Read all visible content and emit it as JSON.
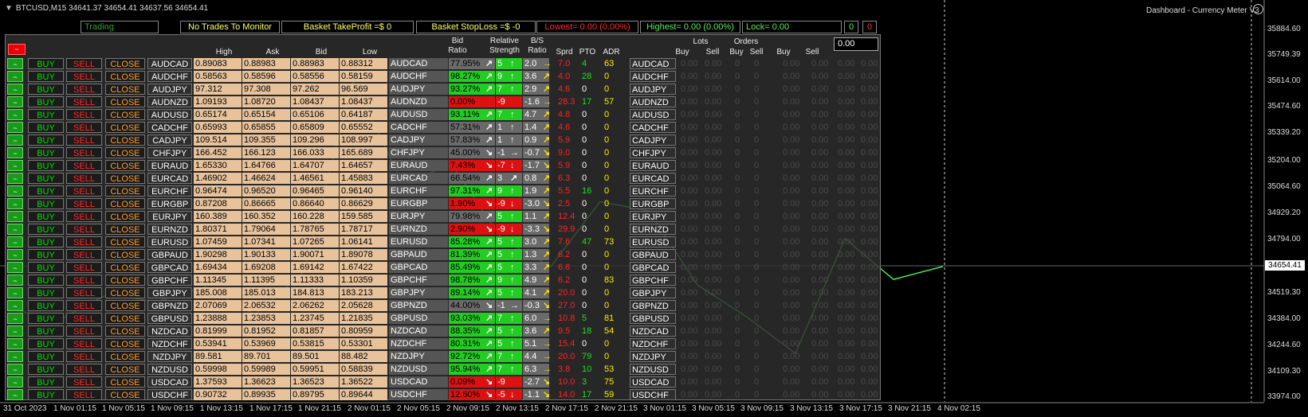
{
  "window": {
    "title": "BTCUSD,M15  34641.37 34654.41 34637.56 34654.41",
    "dashboard_name": "Dashboard - Currency Meter V3"
  },
  "top_bar": {
    "status": "Trading",
    "trades_monitor": "No Trades To Monitor",
    "basket_tp": "Basket TakeProfit =$ 0",
    "basket_sl": "Basket StopLoss =$ -0",
    "lowest": "Lowest= 0.00 (0.00%)",
    "highest": "Highest= 0.00 (0.00%)",
    "lock": "Lock= 0.00",
    "count_green": "0",
    "count_red": "0"
  },
  "headers": {
    "high": "High",
    "ask": "Ask",
    "bid": "Bid",
    "low": "Low",
    "bid_ratio_1": "Bid",
    "bid_ratio_2": "Ratio",
    "rel_strength_1": "Relative",
    "rel_strength_2": "Strength",
    "bs_ratio_1": "B/S",
    "bs_ratio_2": "Ratio",
    "sprd": "Sprd",
    "pto": "PTO",
    "adr": "ADR",
    "lots": "Lots",
    "orders": "Orders",
    "buy1": "Buy",
    "sell1": "Sell",
    "buy2": "Buy",
    "sell2": "Sell",
    "buy3": "Buy",
    "sell3": "Sell",
    "lots_value": "0.00"
  },
  "labels": {
    "toggle": "~",
    "buy": "BUY",
    "sell": "SELL",
    "close": "CLOSE",
    "zero": "0.00",
    "zero_int": "0"
  },
  "colors": {
    "ratio_green": "#22cc22",
    "ratio_red": "#dd1111",
    "ratio_gray": "#6a6a6a",
    "chart_line": "#4cff4c",
    "grid": "#d0d0d0"
  },
  "rows": [
    {
      "symbol": "AUDCAD",
      "high": "0.89083",
      "ask": "0.88983",
      "bid": "0.88983",
      "low": "0.88312",
      "ratio": "77.95%",
      "ratio_color": "gray",
      "rarrow": "↗",
      "strength": "5",
      "sarrow": "↑",
      "bs": "2.0",
      "barrow": "→",
      "sprd": "7.0",
      "pto": "4",
      "adr": "63"
    },
    {
      "symbol": "AUDCHF",
      "high": "0.58563",
      "ask": "0.58596",
      "bid": "0.58556",
      "low": "0.58159",
      "ratio": "98.27%",
      "ratio_color": "green",
      "rarrow": "↗",
      "strength": "9",
      "sarrow": "↑",
      "bs": "3.6",
      "barrow": "↗",
      "sprd": "4.0",
      "pto": "28",
      "adr": "0"
    },
    {
      "symbol": "AUDJPY",
      "high": "97.312",
      "ask": "97.308",
      "bid": "97.262",
      "low": "96.569",
      "ratio": "93.27%",
      "ratio_color": "green",
      "rarrow": "↗",
      "strength": "7",
      "sarrow": "↑",
      "bs": "2.9",
      "barrow": "↗",
      "sprd": "4.6",
      "pto": "0",
      "adr": "0"
    },
    {
      "symbol": "AUDNZD",
      "high": "1.09193",
      "ask": "1.08720",
      "bid": "1.08437",
      "low": "1.08437",
      "ratio": "0.00%",
      "ratio_color": "red",
      "rarrow": "",
      "strength": "-9",
      "sarrow": "",
      "bs": "-1.6",
      "barrow": "→",
      "sprd": "28.3",
      "pto": "17",
      "adr": "57"
    },
    {
      "symbol": "AUDUSD",
      "high": "0.65174",
      "ask": "0.65154",
      "bid": "0.65106",
      "low": "0.64187",
      "ratio": "93.11%",
      "ratio_color": "green",
      "rarrow": "↗",
      "strength": "7",
      "sarrow": "↑",
      "bs": "4.7",
      "barrow": "↗",
      "sprd": "4.8",
      "pto": "0",
      "adr": "0"
    },
    {
      "symbol": "CADCHF",
      "high": "0.65993",
      "ask": "0.65855",
      "bid": "0.65809",
      "low": "0.65552",
      "ratio": "57.31%",
      "ratio_color": "gray",
      "rarrow": "↗",
      "strength": "1",
      "sarrow": "↑",
      "bs": "1.4",
      "barrow": "↗",
      "sprd": "4.6",
      "pto": "0",
      "adr": "0"
    },
    {
      "symbol": "CADJPY",
      "high": "109.514",
      "ask": "109.355",
      "bid": "109.296",
      "low": "108.997",
      "ratio": "57.83%",
      "ratio_color": "gray",
      "rarrow": "↗",
      "strength": "1",
      "sarrow": "↑",
      "bs": "0.9",
      "barrow": "↗",
      "sprd": "5.9",
      "pto": "0",
      "adr": "0"
    },
    {
      "symbol": "CHFJPY",
      "high": "166.452",
      "ask": "166.123",
      "bid": "166.033",
      "low": "165.689",
      "ratio": "45.00%",
      "ratio_color": "gray",
      "rarrow": "↘",
      "strength": "-1",
      "sarrow": "→",
      "bs": "-0.7",
      "barrow": "↘",
      "sprd": "9.0",
      "pto": "0",
      "adr": "0"
    },
    {
      "symbol": "EURAUD",
      "high": "1.65330",
      "ask": "1.64766",
      "bid": "1.64707",
      "low": "1.64657",
      "ratio": "7.43%",
      "ratio_color": "red",
      "rarrow": "↘",
      "strength": "-7",
      "sarrow": "↓",
      "bs": "-1.7",
      "barrow": "↘",
      "sprd": "5.9",
      "pto": "0",
      "adr": "0"
    },
    {
      "symbol": "EURCAD",
      "high": "1.46902",
      "ask": "1.46624",
      "bid": "1.46561",
      "low": "1.45883",
      "ratio": "66.54%",
      "ratio_color": "gray",
      "rarrow": "↗",
      "strength": "3",
      "sarrow": "↗",
      "bs": "0.8",
      "barrow": "↗",
      "sprd": "6.3",
      "pto": "0",
      "adr": "0"
    },
    {
      "symbol": "EURCHF",
      "high": "0.96474",
      "ask": "0.96520",
      "bid": "0.96465",
      "low": "0.96140",
      "ratio": "97.31%",
      "ratio_color": "green",
      "rarrow": "↗",
      "strength": "9",
      "sarrow": "↑",
      "bs": "1.9",
      "barrow": "↗",
      "sprd": "5.5",
      "pto": "16",
      "adr": "0"
    },
    {
      "symbol": "EURGBP",
      "high": "0.87208",
      "ask": "0.86665",
      "bid": "0.86640",
      "low": "0.86629",
      "ratio": "1.90%",
      "ratio_color": "red",
      "rarrow": "↘",
      "strength": "-9",
      "sarrow": "↓",
      "bs": "-3.0",
      "barrow": "↘",
      "sprd": "2.5",
      "pto": "0",
      "adr": "0"
    },
    {
      "symbol": "EURJPY",
      "high": "160.389",
      "ask": "160.352",
      "bid": "160.228",
      "low": "159.585",
      "ratio": "79.98%",
      "ratio_color": "gray",
      "rarrow": "↗",
      "strength": "5",
      "sarrow": "↑",
      "bs": "1.1",
      "barrow": "↗",
      "sprd": "12.4",
      "pto": "0",
      "adr": "0"
    },
    {
      "symbol": "EURNZD",
      "high": "1.80371",
      "ask": "1.79064",
      "bid": "1.78765",
      "low": "1.78717",
      "ratio": "2.90%",
      "ratio_color": "red",
      "rarrow": "↘",
      "strength": "-9",
      "sarrow": "↓",
      "bs": "-3.3",
      "barrow": "↘",
      "sprd": "29.9",
      "pto": "0",
      "adr": "0"
    },
    {
      "symbol": "EURUSD",
      "high": "1.07459",
      "ask": "1.07341",
      "bid": "1.07265",
      "low": "1.06141",
      "ratio": "85.28%",
      "ratio_color": "green",
      "rarrow": "↗",
      "strength": "5",
      "sarrow": "↑",
      "bs": "3.0",
      "barrow": "↗",
      "sprd": "7.6",
      "pto": "47",
      "adr": "73"
    },
    {
      "symbol": "GBPAUD",
      "high": "1.90298",
      "ask": "1.90133",
      "bid": "1.90071",
      "low": "1.89078",
      "ratio": "81.39%",
      "ratio_color": "green",
      "rarrow": "↗",
      "strength": "5",
      "sarrow": "↑",
      "bs": "1.3",
      "barrow": "↗",
      "sprd": "6.2",
      "pto": "0",
      "adr": "0"
    },
    {
      "symbol": "GBPCAD",
      "high": "1.69434",
      "ask": "1.69208",
      "bid": "1.69142",
      "low": "1.67422",
      "ratio": "85.49%",
      "ratio_color": "green",
      "rarrow": "↗",
      "strength": "5",
      "sarrow": "↑",
      "bs": "3.3",
      "barrow": "↗",
      "sprd": "6.6",
      "pto": "0",
      "adr": "0"
    },
    {
      "symbol": "GBPCHF",
      "high": "1.11345",
      "ask": "1.11395",
      "bid": "1.11333",
      "low": "1.10359",
      "ratio": "98.78%",
      "ratio_color": "green",
      "rarrow": "↗",
      "strength": "9",
      "sarrow": "↑",
      "bs": "4.9",
      "barrow": "↗",
      "sprd": "6.2",
      "pto": "0",
      "adr": "83"
    },
    {
      "symbol": "GBPJPY",
      "high": "185.008",
      "ask": "185.013",
      "bid": "184.813",
      "low": "183.213",
      "ratio": "89.14%",
      "ratio_color": "green",
      "rarrow": "↗",
      "strength": "5",
      "sarrow": "↑",
      "bs": "4.1",
      "barrow": "↗",
      "sprd": "20.0",
      "pto": "0",
      "adr": "0"
    },
    {
      "symbol": "GBPNZD",
      "high": "2.07069",
      "ask": "2.06532",
      "bid": "2.06262",
      "low": "2.05628",
      "ratio": "44.00%",
      "ratio_color": "gray",
      "rarrow": "↘",
      "strength": "-1",
      "sarrow": "→",
      "bs": "-0.3",
      "barrow": "↘",
      "sprd": "27.0",
      "pto": "0",
      "adr": "0"
    },
    {
      "symbol": "GBPUSD",
      "high": "1.23888",
      "ask": "1.23853",
      "bid": "1.23745",
      "low": "1.21835",
      "ratio": "93.03%",
      "ratio_color": "green",
      "rarrow": "↗",
      "strength": "7",
      "sarrow": "↑",
      "bs": "6.0",
      "barrow": "→",
      "sprd": "10.8",
      "pto": "5",
      "adr": "81"
    },
    {
      "symbol": "NZDCAD",
      "high": "0.81999",
      "ask": "0.81952",
      "bid": "0.81857",
      "low": "0.80959",
      "ratio": "88.35%",
      "ratio_color": "green",
      "rarrow": "↗",
      "strength": "5",
      "sarrow": "↑",
      "bs": "3.6",
      "barrow": "↗",
      "sprd": "9.5",
      "pto": "18",
      "adr": "54"
    },
    {
      "symbol": "NZDCHF",
      "high": "0.53941",
      "ask": "0.53969",
      "bid": "0.53815",
      "low": "0.53301",
      "ratio": "80.31%",
      "ratio_color": "green",
      "rarrow": "↗",
      "strength": "5",
      "sarrow": "↑",
      "bs": "5.1",
      "barrow": "→",
      "sprd": "15.4",
      "pto": "0",
      "adr": "0"
    },
    {
      "symbol": "NZDJPY",
      "high": "89.581",
      "ask": "89.701",
      "bid": "89.501",
      "low": "88.482",
      "ratio": "92.72%",
      "ratio_color": "green",
      "rarrow": "↗",
      "strength": "7",
      "sarrow": "↑",
      "bs": "4.4",
      "barrow": "→",
      "sprd": "20.0",
      "pto": "79",
      "adr": "0"
    },
    {
      "symbol": "NZDUSD",
      "high": "0.59998",
      "ask": "0.59989",
      "bid": "0.59951",
      "low": "0.58839",
      "ratio": "95.94%",
      "ratio_color": "green",
      "rarrow": "↗",
      "strength": "7",
      "sarrow": "↑",
      "bs": "6.3",
      "barrow": "→",
      "sprd": "3.8",
      "pto": "10",
      "adr": "53"
    },
    {
      "symbol": "USDCAD",
      "high": "1.37593",
      "ask": "1.36623",
      "bid": "1.36523",
      "low": "1.36522",
      "ratio": "0.09%",
      "ratio_color": "red",
      "rarrow": "↘",
      "strength": "-9",
      "sarrow": "",
      "bs": "-2.7",
      "barrow": "↘",
      "sprd": "10.0",
      "pto": "3",
      "adr": "75"
    },
    {
      "symbol": "USDCHF",
      "high": "0.90732",
      "ask": "0.89935",
      "bid": "0.89795",
      "low": "0.89644",
      "ratio": "12.60%",
      "ratio_color": "red",
      "rarrow": "↘",
      "strength": "-5",
      "sarrow": "↓",
      "bs": "-1.1",
      "barrow": "↘",
      "sprd": "14.0",
      "pto": "17",
      "adr": "59"
    }
  ],
  "x_axis": [
    "31 Oct 2023",
    "1 Nov 01:15",
    "1 Nov 05:15",
    "1 Nov 09:15",
    "1 Nov 13:15",
    "1 Nov 17:15",
    "1 Nov 21:15",
    "2 Nov 01:15",
    "2 Nov 05:15",
    "2 Nov 09:15",
    "2 Nov 13:15",
    "2 Nov 17:15",
    "2 Nov 21:15",
    "3 Nov 01:15",
    "3 Nov 05:15",
    "3 Nov 09:15",
    "3 Nov 13:15",
    "3 Nov 17:15",
    "3 Nov 21:15",
    "4 Nov 02:15"
  ],
  "y_axis": [
    "35884.60",
    "35749.39",
    "35614.00",
    "35474.60",
    "35339.20",
    "35204.00",
    "35064.60",
    "34929.20",
    "34794.00",
    "34519.30",
    "34384.00",
    "34244.60",
    "34109.30",
    "33974.00"
  ],
  "current_price": "34654.41",
  "chart_data": {
    "type": "line",
    "x": [
      "31 Oct 2023",
      "1 Nov 01:15",
      "1 Nov 05:15",
      "1 Nov 09:15",
      "1 Nov 13:15",
      "1 Nov 17:15",
      "1 Nov 21:15",
      "2 Nov 01:15",
      "2 Nov 05:15",
      "2 Nov 09:15",
      "2 Nov 13:15",
      "2 Nov 17:15",
      "2 Nov 21:15",
      "3 Nov 01:15",
      "3 Nov 05:15",
      "3 Nov 09:15",
      "3 Nov 13:15",
      "3 Nov 17:15",
      "3 Nov 21:15",
      "4 Nov 02:15"
    ],
    "series": [
      {
        "values": [
          34420,
          34360,
          34500,
          34460,
          34540,
          34390,
          34620,
          35650,
          35100,
          35200,
          34800,
          34650,
          35000,
          34950,
          34550,
          34380,
          34180,
          34800,
          34580,
          34650
        ]
      }
    ],
    "ylim": [
      33940,
      35960
    ]
  }
}
